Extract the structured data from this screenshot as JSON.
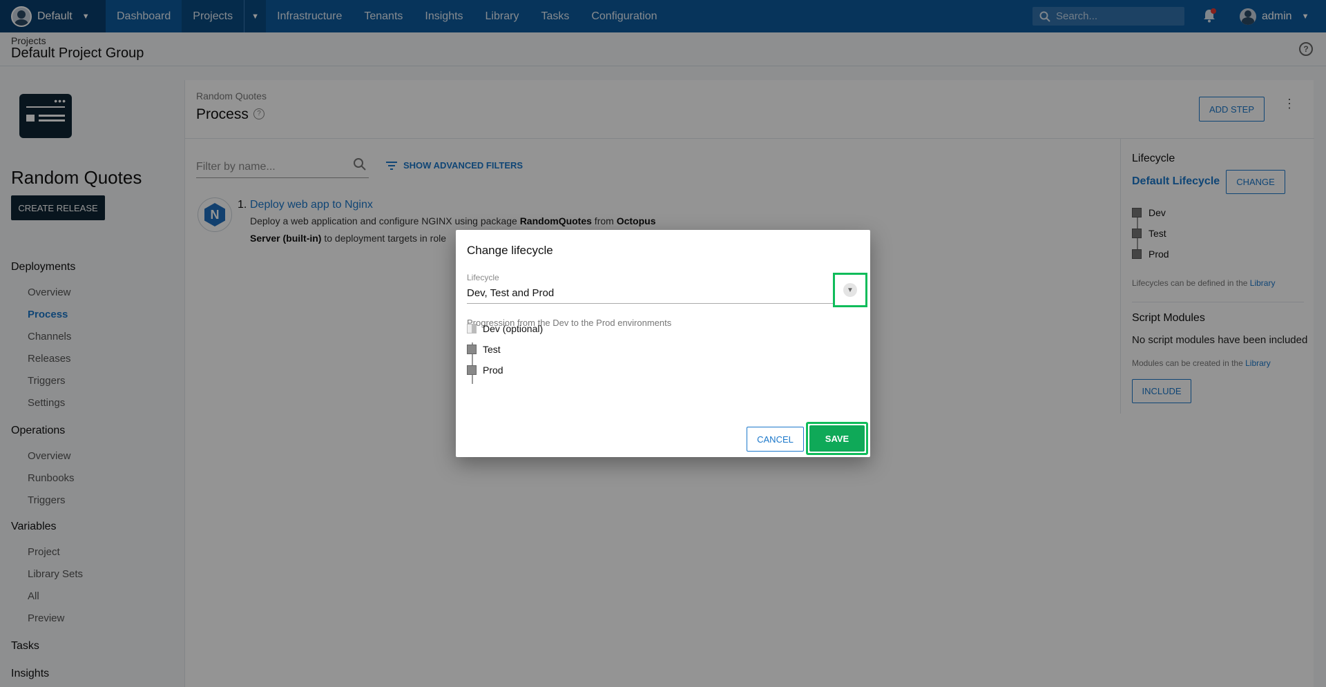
{
  "nav": {
    "space": "Default",
    "items": [
      "Dashboard",
      "Projects",
      "Infrastructure",
      "Tenants",
      "Insights",
      "Library",
      "Tasks",
      "Configuration"
    ],
    "active": "Projects",
    "search_placeholder": "Search...",
    "user": "admin"
  },
  "page": {
    "breadcrumb": "Projects",
    "group_title": "Default Project Group"
  },
  "sidebar": {
    "project_name": "Random Quotes",
    "create_release": "CREATE RELEASE",
    "deployments": {
      "label": "Deployments",
      "items": [
        "Overview",
        "Process",
        "Channels",
        "Releases",
        "Triggers",
        "Settings"
      ]
    },
    "operations": {
      "label": "Operations",
      "items": [
        "Overview",
        "Runbooks",
        "Triggers"
      ]
    },
    "variables": {
      "label": "Variables",
      "items": [
        "Project",
        "Library Sets",
        "All",
        "Preview"
      ]
    },
    "tasks": "Tasks",
    "insights": "Insights"
  },
  "main": {
    "breadcrumb": "Random Quotes",
    "title": "Process",
    "add_step": "ADD STEP",
    "filter_placeholder": "Filter by name...",
    "advanced_filters": "SHOW ADVANCED FILTERS",
    "step": {
      "number": "1.",
      "title": "Deploy web app to Nginx",
      "desc_prefix": "Deploy a web application and configure NGINX using package ",
      "package": "RandomQuotes",
      "desc_from": " from ",
      "feed": "Octopus Server (built-in)",
      "desc_suffix": " to deployment targets in role"
    }
  },
  "right_panel": {
    "lifecycle_heading": "Lifecycle",
    "lifecycle_name": "Default Lifecycle",
    "change": "CHANGE",
    "environments": [
      "Dev",
      "Test",
      "Prod"
    ],
    "lifecycle_note": "Lifecycles can be defined in the ",
    "library_link": "Library",
    "script_heading": "Script Modules",
    "script_text": "No script modules have been included",
    "modules_note": "Modules can be created in the ",
    "include": "INCLUDE"
  },
  "dialog": {
    "title": "Change lifecycle",
    "field_label": "Lifecycle",
    "field_value": "Dev, Test and Prod",
    "description": "Progression from the Dev to the Prod environments",
    "environments": [
      "Dev (optional)",
      "Test",
      "Prod"
    ],
    "cancel": "CANCEL",
    "save": "SAVE"
  },
  "colors": {
    "nav_bg": "#0d5a9e",
    "accent": "#1a77ca",
    "highlight": "#0fbc5a",
    "save_bg": "#0fa958"
  }
}
